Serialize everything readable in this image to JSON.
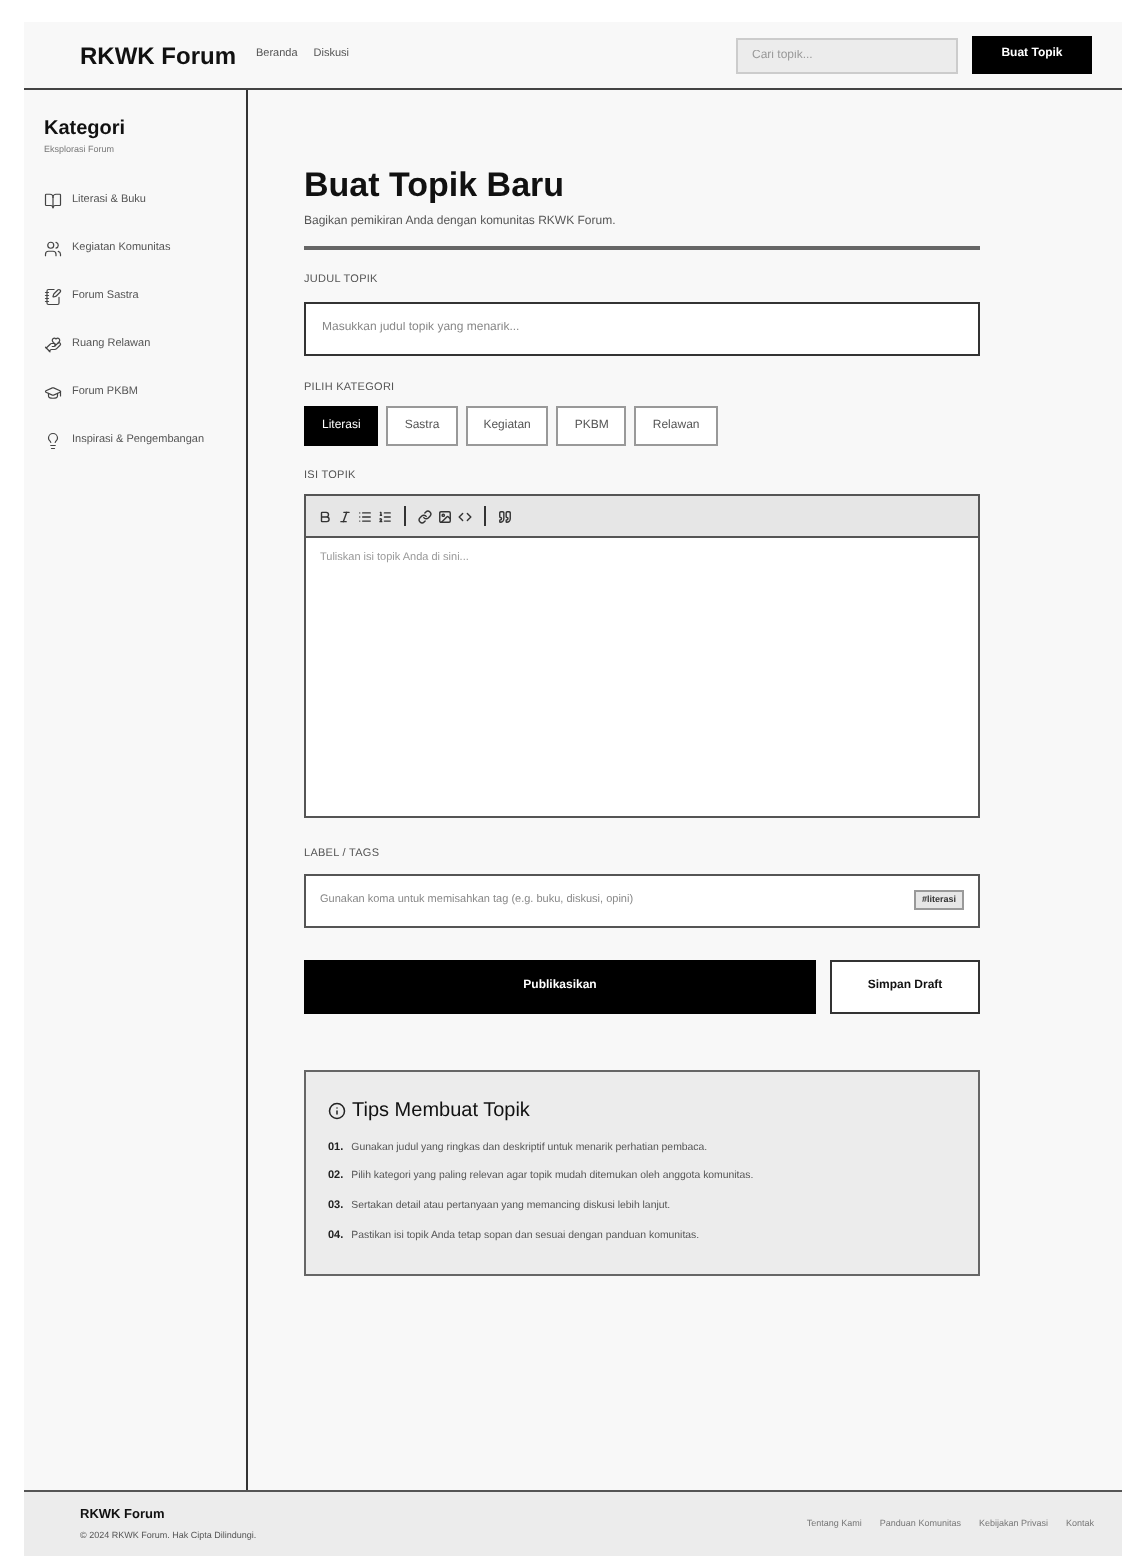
{
  "header": {
    "logo": "RKWK Forum",
    "nav": [
      "Beranda",
      "Diskusi"
    ],
    "search": {
      "placeholder": "Cari topik..."
    },
    "create_button": "Buat Topik"
  },
  "sidebar": {
    "title": "Kategori",
    "subtitle": "Eksplorasi Forum",
    "items": [
      {
        "label": "Literasi & Buku"
      },
      {
        "label": "Kegiatan Komunitas"
      },
      {
        "label": "Forum Sastra"
      },
      {
        "label": "Ruang Relawan"
      },
      {
        "label": "Forum PKBM"
      },
      {
        "label": "Inspirasi & Pengembangan"
      }
    ]
  },
  "form": {
    "title": "Buat Topik Baru",
    "subtitle": "Bagikan pemikiran Anda dengan komunitas RKWK Forum.",
    "title_field": {
      "label": "JUDUL TOPIK",
      "placeholder": "Masukkan judul topik yang menarik..."
    },
    "category": {
      "label": "PILIH KATEGORI",
      "options": [
        {
          "label": "Literasi",
          "selected": true
        },
        {
          "label": "Sastra",
          "selected": false
        },
        {
          "label": "Kegiatan",
          "selected": false
        },
        {
          "label": "PKBM",
          "selected": false
        },
        {
          "label": "Relawan",
          "selected": false
        }
      ]
    },
    "body": {
      "label": "ISI TOPIK",
      "placeholder": "Tuliskan isi topik Anda di sini..."
    },
    "tags": {
      "label": "LABEL / TAGS",
      "placeholder": "Gunakan koma untuk memisahkan tag (e.g. buku, diskusi, opini)",
      "chips": [
        "#literasi"
      ]
    },
    "publish_button": "Publikasikan",
    "draft_button": "Simpan Draft"
  },
  "tips": {
    "title": "Tips Membuat Topik",
    "items": [
      {
        "number": "01.",
        "text": "Gunakan judul yang ringkas dan deskriptif untuk menarik perhatian pembaca."
      },
      {
        "number": "02.",
        "text": "Pilih kategori yang paling relevan agar topik mudah ditemukan oleh anggota komunitas."
      },
      {
        "number": "03.",
        "text": "Sertakan detail atau pertanyaan yang memancing diskusi lebih lanjut."
      },
      {
        "number": "04.",
        "text": "Pastikan isi topik Anda tetap sopan dan sesuai dengan panduan komunitas."
      }
    ]
  },
  "footer": {
    "logo": "RKWK Forum",
    "copyright": "© 2024 RKWK Forum. Hak Cipta Dilindungi.",
    "links": [
      "Tentang Kami",
      "Panduan Komunitas",
      "Kebijakan Privasi",
      "Kontak"
    ]
  }
}
